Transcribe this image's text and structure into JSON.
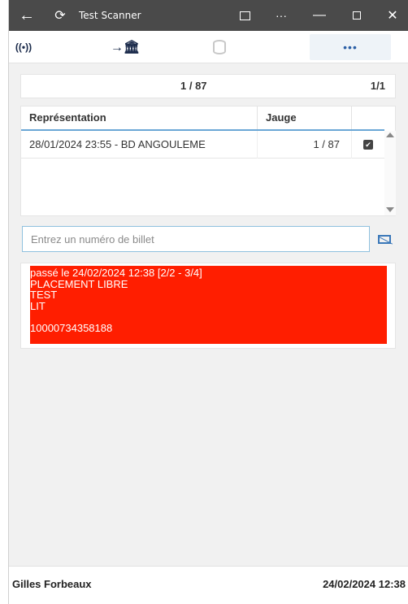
{
  "window": {
    "title": "Test Scanner",
    "back_icon": "←",
    "sync_icon": "⟳",
    "more_icon": "···",
    "minimize_icon": "—",
    "close_icon": "✕"
  },
  "toolbar": {
    "rfid_icon": "((•))",
    "transfer_icon": "→🏛",
    "more_label": "•••"
  },
  "counter": {
    "center": "1 / 87",
    "right": "1/1"
  },
  "grid": {
    "headers": {
      "representation": "Représentation",
      "jauge": "Jauge"
    },
    "rows": [
      {
        "representation": "28/01/2024 23:55 - BD ANGOULEME",
        "jauge": "1 / 87",
        "checked": true
      }
    ]
  },
  "ticket_input": {
    "value": "",
    "placeholder": "Entrez un numéro de billet"
  },
  "result": {
    "background": "#ff1e00",
    "lines": [
      "passé le 24/02/2024 12:38 [2/2 - 3/4]",
      "PLACEMENT LIBRE",
      "TEST",
      "LIT",
      "",
      "10000734358188"
    ]
  },
  "status": {
    "user": "Gilles Forbeaux",
    "datetime": "24/02/2024 12:38"
  }
}
